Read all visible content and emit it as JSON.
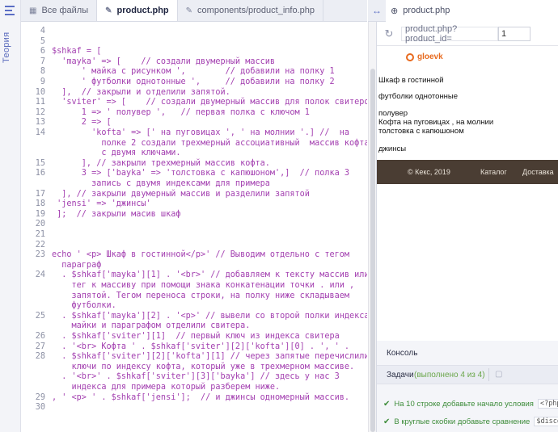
{
  "rail": {
    "vertical_label": "Теория"
  },
  "tabs": [
    {
      "label": "Все файлы",
      "icon": "grid-icon"
    },
    {
      "label": "product.php",
      "icon": "pin-icon",
      "active": true
    },
    {
      "label": "components/product_info.php",
      "icon": "pin-icon"
    }
  ],
  "editor": {
    "lines": [
      {
        "n": "4",
        "t": ""
      },
      {
        "n": "5",
        "t": ""
      },
      {
        "n": "6",
        "t": "$shkaf = ["
      },
      {
        "n": "7",
        "t": "  'mayka' => [    // создали двумерный массив"
      },
      {
        "n": "8",
        "t": "      ' майка с рисунком ',        // добавили на полку 1"
      },
      {
        "n": "9",
        "t": "      ' футболки однотонные ',     // добавили на полку 2"
      },
      {
        "n": "10",
        "t": "  ],  // закрыли и отделили запятой."
      },
      {
        "n": "11",
        "t": "  'sviter' => [    // создали двумерный массив для полок свитеров"
      },
      {
        "n": "12",
        "t": "      1 => ' полувер ',   // первая полка с ключом 1"
      },
      {
        "n": "13",
        "t": "      2 => ["
      },
      {
        "n": "14",
        "t": "        'kofta' => [' на пуговицах ', ' на молнии '.] //  на"
      },
      {
        "n": "",
        "t": "          полке 2 создали трехмерный ассоциативный  массив кофта"
      },
      {
        "n": "",
        "t": "          с двумя ключами."
      },
      {
        "n": "15",
        "t": "      ], // закрыли трехмерный массив кофта."
      },
      {
        "n": "16",
        "t": "      3 => ['bayka' => 'толстовка с капюшоном',]  // полка 3"
      },
      {
        "n": "",
        "t": "        запись с двумя индексами для примера"
      },
      {
        "n": "17",
        "t": "  ], // закрыли двумерный массив и разделили запятой"
      },
      {
        "n": "18",
        "t": " 'jensi' => 'джинсы'"
      },
      {
        "n": "19",
        "t": " ];  // закрыли масив шкаф"
      },
      {
        "n": "20",
        "t": ""
      },
      {
        "n": "21",
        "t": ""
      },
      {
        "n": "22",
        "t": ""
      },
      {
        "n": "23",
        "t": "echo ' <p> Шкаф в гостинной</p>' // Выводим отдельно с тегом"
      },
      {
        "n": "",
        "t": "  параграф"
      },
      {
        "n": "24",
        "t": "  . $shkaf['mayka'][1] . '<br>' // добавляем к тексту массив или"
      },
      {
        "n": "",
        "t": "    тег к массиву при помощи знака конкатенации точки . или ,"
      },
      {
        "n": "",
        "t": "    запятой. Тегом переноса строки, на полку ниже складываем"
      },
      {
        "n": "",
        "t": "    футболки."
      },
      {
        "n": "25",
        "t": "  . $shkaf['mayka'][2] . '<p>' // вывели со второй полки индекса"
      },
      {
        "n": "",
        "t": "    майки и параграфом отделили свитера."
      },
      {
        "n": "26",
        "t": "  . $shkaf['sviter'][1]  // первый ключ из индекса свитера"
      },
      {
        "n": "27",
        "t": "  . '<br> Кофта ' . $shkaf['sviter'][2]['kofta'][0] . ', ' ."
      },
      {
        "n": "28",
        "t": "  . $shkaf['sviter'][2]['kofta'][1] // через запятые перечислили"
      },
      {
        "n": "",
        "t": "    ключи по индексу кофта, который уже в трехмерном массиве."
      },
      {
        "n": "",
        "t": "  . '<br>' . $shkaf['sviter'][3]['bayka'] // здесь у нас 3"
      },
      {
        "n": "",
        "t": "    индекса для примера который разберем ниже."
      },
      {
        "n": "29",
        "t": ", ' <p> ' . $shkaf['jensi'];  // и джинсы одномерный массив."
      },
      {
        "n": "30",
        "t": ""
      }
    ]
  },
  "right_tab": {
    "swap_icon": "swap-arrows-icon",
    "label": "product.php",
    "icon": "globe-icon"
  },
  "urlbar": {
    "path": "product.php?product_id=",
    "value": "1"
  },
  "preview": {
    "logo": "gloevk",
    "text1": "Шкаф в гостинной",
    "text2": "футболки однотонные",
    "text3": "полувер",
    "text4": "Кофта на пуговицах , на молнии",
    "text5": "толстовка с капюшоном",
    "text6": "джинсы",
    "footer_copy": "© Кекс, 2019",
    "footer_catalog": "Каталог",
    "footer_delivery": "Доставка"
  },
  "console": {
    "title": "Консоль",
    "tasks_label": "Задачи",
    "tasks_status": "(выполнено 4 из 4)",
    "task1_text": "На 10 строке добавьте начало условия",
    "task1_code": "<?php",
    "task2_text": "В круглые скобки добавьте сравнение",
    "task2_code": "$disco"
  }
}
